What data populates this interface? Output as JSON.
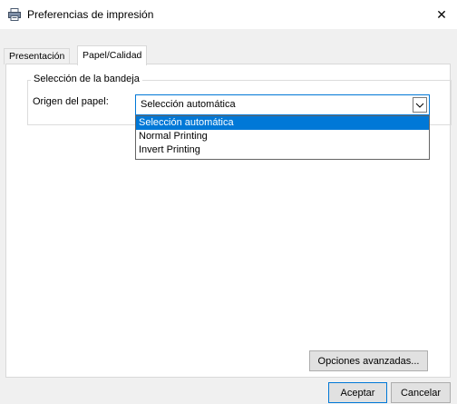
{
  "window": {
    "title": "Preferencias de impresión",
    "icon": "printer-icon",
    "close_glyph": "✕"
  },
  "tabs": [
    {
      "label": "Presentación",
      "active": false
    },
    {
      "label": "Papel/Calidad",
      "active": true
    }
  ],
  "tray_group": {
    "legend": "Selección de la bandeja",
    "origin_label": "Origen del papel:",
    "origin_value": "Selección automática",
    "options": [
      "Selección automática",
      "Normal Printing",
      "Invert Printing"
    ]
  },
  "buttons": {
    "advanced": "Opciones avanzadas...",
    "ok": "Aceptar",
    "cancel": "Cancelar"
  },
  "colors": {
    "accent": "#0078d7",
    "background": "#f0f0f0"
  }
}
